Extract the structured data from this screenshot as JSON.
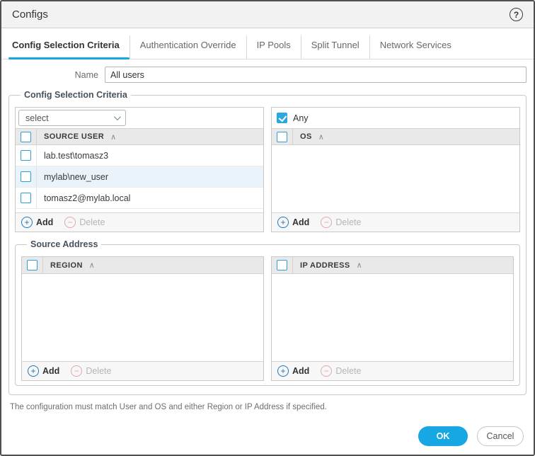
{
  "window": {
    "title": "Configs"
  },
  "icons": {
    "help": "?",
    "sort_ascending": "∧",
    "add": "+",
    "delete": "−"
  },
  "tabs": [
    {
      "label": "Config Selection Criteria",
      "active": true
    },
    {
      "label": "Authentication Override",
      "active": false
    },
    {
      "label": "IP Pools",
      "active": false
    },
    {
      "label": "Split Tunnel",
      "active": false
    },
    {
      "label": "Network Services",
      "active": false
    }
  ],
  "form": {
    "name_label": "Name",
    "name_value": "All users"
  },
  "criteria": {
    "legend": "Config Selection Criteria",
    "user_panel": {
      "select_placeholder": "select",
      "header": "SOURCE USER",
      "rows": [
        "lab.test\\tomasz3",
        "mylab\\new_user",
        "tomasz2@mylab.local"
      ],
      "selected_row_index": 1
    },
    "os_panel": {
      "any_label": "Any",
      "any_checked": true,
      "header": "OS"
    },
    "source_address": {
      "legend": "Source Address",
      "region_panel": {
        "header": "REGION"
      },
      "ip_panel": {
        "header": "IP ADDRESS"
      }
    },
    "actions": {
      "add": "Add",
      "delete": "Delete"
    }
  },
  "note": "The configuration must match User and OS and either Region or IP Address if specified.",
  "footer": {
    "ok": "OK",
    "cancel": "Cancel"
  },
  "colors": {
    "accent": "#17a7e3",
    "checkbox_border": "#2ba0d4",
    "checkbox_checked": "#29a9e0",
    "selected_row": "#e9f3f9",
    "add_icon": "#2077b4",
    "delete_icon": "#e3a6aa"
  }
}
